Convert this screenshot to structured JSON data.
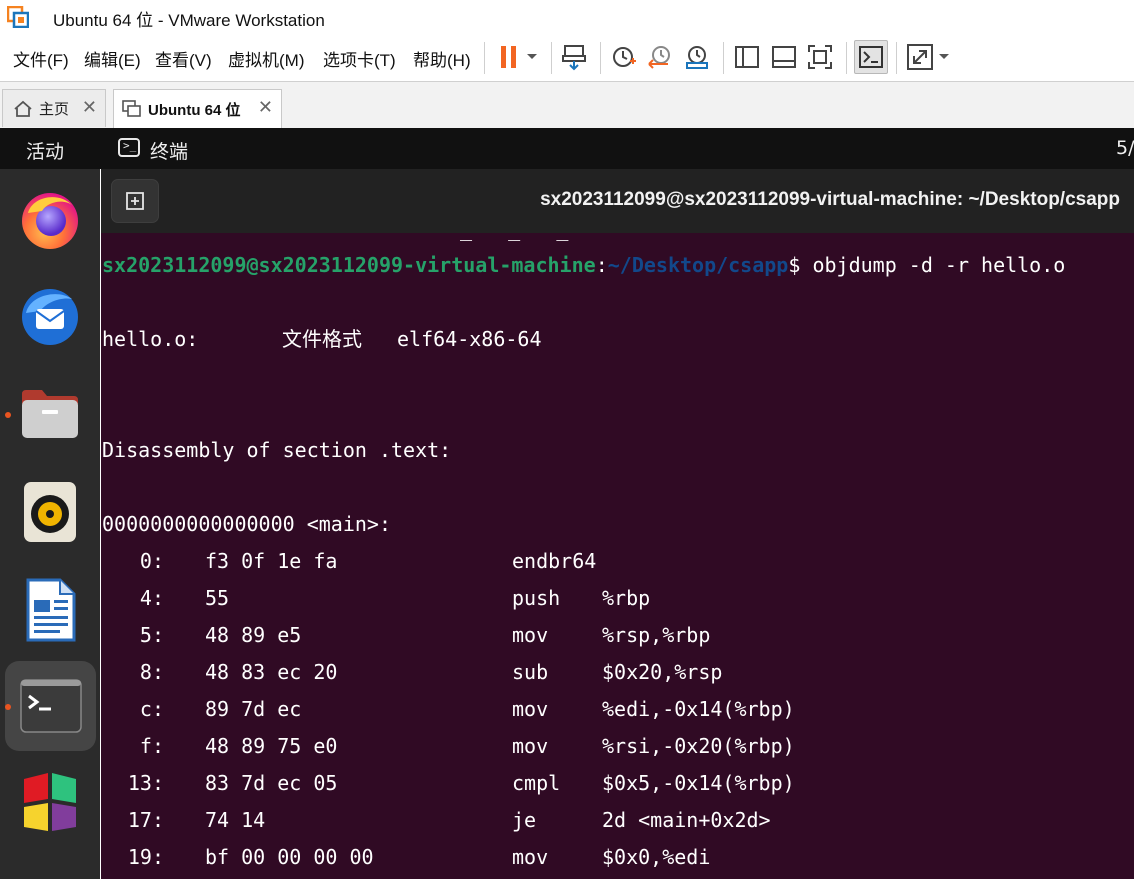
{
  "window": {
    "title": "Ubuntu 64 位 - VMware Workstation"
  },
  "menu": [
    "文件(F)",
    "编辑(E)",
    "查看(V)",
    "虚拟机(M)",
    "选项卡(T)",
    "帮助(H)"
  ],
  "toolbar_icons": [
    "pause-icon",
    "dropdown-arrow-icon",
    "send-ctrl-alt-del-icon",
    "snapshot-icon",
    "revert-snapshot-icon",
    "manage-snapshots-icon",
    "sidebar-icon",
    "thumbnail-bar-icon",
    "fullscreen-fit-icon",
    "console-view-icon",
    "stretch-guest-icon"
  ],
  "tabs": [
    {
      "label": "主页",
      "icon": "home-icon"
    },
    {
      "label": "Ubuntu 64 位",
      "icon": "vm-icon",
      "active": true
    }
  ],
  "gnome": {
    "activities": "活动",
    "app_name": "终端",
    "app_icon_glyph": ">_",
    "clock_fragment": "5/"
  },
  "dock": [
    "firefox-icon",
    "thunderbird-icon",
    "files-icon",
    "rhythmbox-icon",
    "libreoffice-writer-icon",
    "terminal-icon",
    "software-store-icon"
  ],
  "terminal": {
    "title": "sx2023112099@sx2023112099-virtual-machine: ~/Desktop/csapp",
    "partial_line": "_   _   _",
    "prompt": {
      "user_host": "sx2023112099@sx2023112099-virtual-machine",
      "colon": ":",
      "path": "~/Desktop/csapp",
      "dollar": "$",
      "command": " objdump -d -r hello.o"
    },
    "file_line": {
      "name": "hello.o:",
      "label": "文件格式",
      "value": "elf64-x86-64"
    },
    "section_header": "Disassembly of section .text:",
    "symbol_header": "0000000000000000 <main>:",
    "rows": [
      {
        "addr": "0:",
        "bytes": "f3 0f 1e fa",
        "op": "endbr64",
        "args": ""
      },
      {
        "addr": "4:",
        "bytes": "55",
        "op": "push",
        "args": "%rbp"
      },
      {
        "addr": "5:",
        "bytes": "48 89 e5",
        "op": "mov",
        "args": "%rsp,%rbp"
      },
      {
        "addr": "8:",
        "bytes": "48 83 ec 20",
        "op": "sub",
        "args": "$0x20,%rsp"
      },
      {
        "addr": "c:",
        "bytes": "89 7d ec",
        "op": "mov",
        "args": "%edi,-0x14(%rbp)"
      },
      {
        "addr": "f:",
        "bytes": "48 89 75 e0",
        "op": "mov",
        "args": "%rsi,-0x20(%rbp)"
      },
      {
        "addr": "13:",
        "bytes": "83 7d ec 05",
        "op": "cmpl",
        "args": "$0x5,-0x14(%rbp)"
      },
      {
        "addr": "17:",
        "bytes": "74 14",
        "op": "je",
        "args": "2d <main+0x2d>"
      },
      {
        "addr": "19:",
        "bytes": "bf 00 00 00 00",
        "op": "mov",
        "args": "$0x0,%edi"
      }
    ]
  },
  "colors": {
    "terminal_bg": "#300a24",
    "prompt_user": "#26a269",
    "prompt_path": "#12488b",
    "pause_orange": "#f26522",
    "dock_bg": "#2b2b2b"
  }
}
